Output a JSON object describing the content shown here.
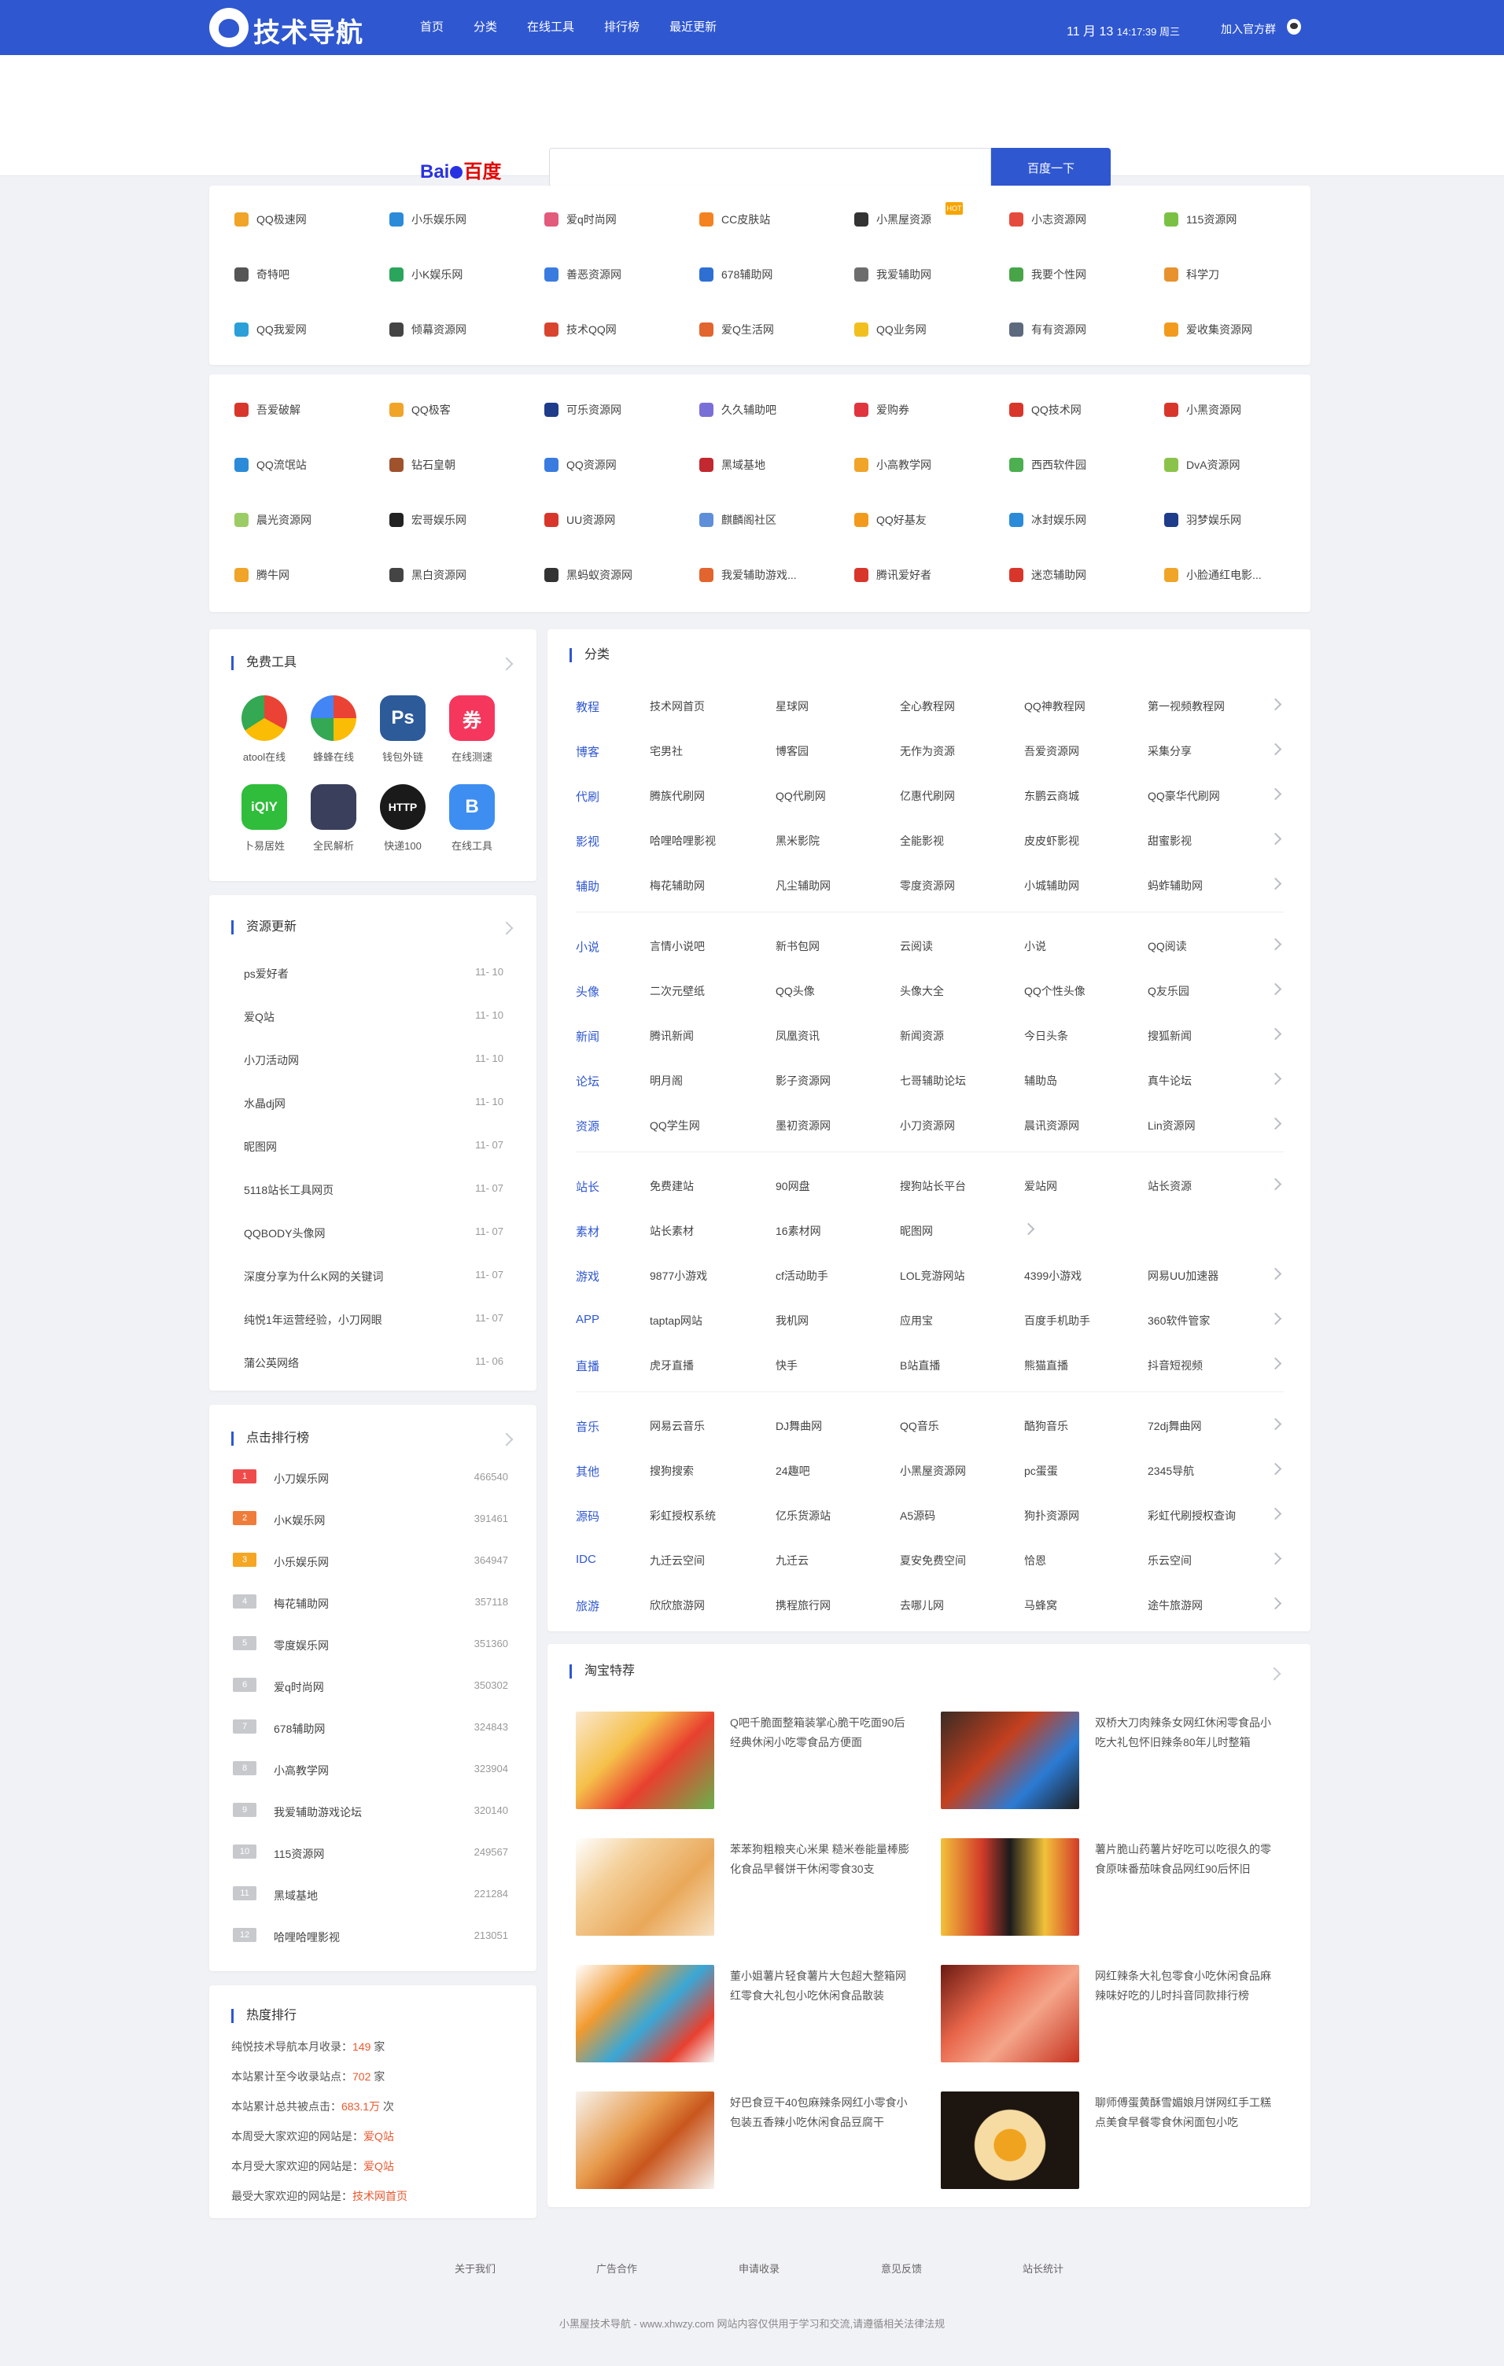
{
  "header": {
    "logo_text": "技术导航",
    "nav": [
      "首页",
      "分类",
      "在线工具",
      "排行榜",
      "最近更新"
    ],
    "date": "11 月 13",
    "time": "14:17:39 周三",
    "join_label": "加入官方群"
  },
  "search": {
    "engine": "百度",
    "button": "百度一下"
  },
  "sites_block1": [
    {
      "name": "QQ极速网",
      "color": "#f0a428"
    },
    {
      "name": "小乐娱乐网",
      "color": "#2b8bd8"
    },
    {
      "name": "爱q时尚网",
      "color": "#e25a7c"
    },
    {
      "name": "CC皮肤站",
      "color": "#f58220"
    },
    {
      "name": "小黑屋资源",
      "color": "#333333",
      "hot": "HOT"
    },
    {
      "name": "小志资源网",
      "color": "#e54b3c"
    },
    {
      "name": "115资源网",
      "color": "#7ac143"
    },
    {
      "name": "奇特吧",
      "color": "#555555"
    },
    {
      "name": "小K娱乐网",
      "color": "#2aa55c"
    },
    {
      "name": "善恶资源网",
      "color": "#3a7be0"
    },
    {
      "name": "678辅助网",
      "color": "#2e6fd4"
    },
    {
      "name": "我爱辅助网",
      "color": "#6d6d6d"
    },
    {
      "name": "我要个性网",
      "color": "#47a548"
    },
    {
      "name": "科学刀",
      "color": "#e8922e"
    },
    {
      "name": "QQ我爱网",
      "color": "#2b9fd8"
    },
    {
      "name": "倾幕资源网",
      "color": "#444444"
    },
    {
      "name": "技术QQ网",
      "color": "#d9442f"
    },
    {
      "name": "爱Q生活网",
      "color": "#e2642e"
    },
    {
      "name": "QQ业务网",
      "color": "#f2c01e"
    },
    {
      "name": "有有资源网",
      "color": "#5d6a7d"
    },
    {
      "name": "爱收集资源网",
      "color": "#f29a1e"
    }
  ],
  "sites_block2": [
    {
      "name": "吾爱破解",
      "color": "#d9362b"
    },
    {
      "name": "QQ极客",
      "color": "#f0a428"
    },
    {
      "name": "可乐资源网",
      "color": "#1f3c8a"
    },
    {
      "name": "久久辅助吧",
      "color": "#7a6fd6"
    },
    {
      "name": "爱购券",
      "color": "#e0353f"
    },
    {
      "name": "QQ技术网",
      "color": "#d9362b"
    },
    {
      "name": "小黑资源网",
      "color": "#d9362b"
    },
    {
      "name": "QQ流氓站",
      "color": "#2b8bd8"
    },
    {
      "name": "钻石皇朝",
      "color": "#a0522d"
    },
    {
      "name": "QQ资源网",
      "color": "#3a7be0"
    },
    {
      "name": "黑域基地",
      "color": "#c2282f"
    },
    {
      "name": "小高教学网",
      "color": "#f0a428"
    },
    {
      "name": "西西软件园",
      "color": "#4caf50"
    },
    {
      "name": "DvA资源网",
      "color": "#8bc34a"
    },
    {
      "name": "晨光资源网",
      "color": "#9ccc65"
    },
    {
      "name": "宏哥娱乐网",
      "color": "#222222"
    },
    {
      "name": "UU资源网",
      "color": "#d9362b"
    },
    {
      "name": "麒麟阁社区",
      "color": "#5f8fd9"
    },
    {
      "name": "QQ好基友",
      "color": "#f29a1e"
    },
    {
      "name": "冰封娱乐网",
      "color": "#2b8bd8"
    },
    {
      "name": "羽梦娱乐网",
      "color": "#1f3c8a"
    },
    {
      "name": "腾牛网",
      "color": "#f0a428"
    },
    {
      "name": "黑白资源网",
      "color": "#444444"
    },
    {
      "name": "黑蚂蚁资源网",
      "color": "#333333"
    },
    {
      "name": "我爱辅助游戏...",
      "color": "#e2642e"
    },
    {
      "name": "腾讯爱好者",
      "color": "#d9362b"
    },
    {
      "name": "迷恋辅助网",
      "color": "#d9362b"
    },
    {
      "name": "小脸通红电影...",
      "color": "#f0a428"
    }
  ],
  "tools": {
    "title": "免费工具",
    "apps": [
      {
        "label": "atool在线",
        "glyph": "",
        "color": "#ffffff"
      },
      {
        "label": "蜂蜂在线",
        "glyph": "",
        "color": "#ffffff"
      },
      {
        "label": "钱包外链",
        "glyph": "Ps",
        "color": "#2d5b9a"
      },
      {
        "label": "在线测速",
        "glyph": "券",
        "color": "#f5375d"
      },
      {
        "label": "卜易居姓",
        "glyph": "iQIY",
        "color": "#2fbd3b"
      },
      {
        "label": "全民解析",
        "glyph": "",
        "color": "#3a3f5c"
      },
      {
        "label": "快递100",
        "glyph": "HTTP",
        "color": "#1a1a1a"
      },
      {
        "label": "在线工具",
        "glyph": "B",
        "color": "#3d8ef0"
      }
    ]
  },
  "resources": {
    "title": "资源更新",
    "items": [
      {
        "name": "ps爱好者",
        "date": "11- 10"
      },
      {
        "name": "爱Q站",
        "date": "11- 10"
      },
      {
        "name": "小刀活动网",
        "date": "11- 10"
      },
      {
        "name": "水晶dj网",
        "date": "11- 10"
      },
      {
        "name": "昵图网",
        "date": "11- 07"
      },
      {
        "name": "5118站长工具网页",
        "date": "11- 07"
      },
      {
        "name": "QQBODY头像网",
        "date": "11- 07"
      },
      {
        "name": "深度分享为什么K网的关键词",
        "date": "11- 07"
      },
      {
        "name": "纯悦1年运营经验，小刀网眼",
        "date": "11- 07"
      },
      {
        "name": "蒲公英网络",
        "date": "11- 06"
      }
    ]
  },
  "ranking": {
    "title": "点击排行榜",
    "items": [
      {
        "num": "1",
        "name": "小刀娱乐网",
        "val": "466540",
        "color": "#f04b4b"
      },
      {
        "num": "2",
        "name": "小K娱乐网",
        "val": "391461",
        "color": "#f07c3a"
      },
      {
        "num": "3",
        "name": "小乐娱乐网",
        "val": "364947",
        "color": "#f5a623"
      },
      {
        "num": "4",
        "name": "梅花辅助网",
        "val": "357118",
        "color": "#c7c9cd"
      },
      {
        "num": "5",
        "name": "零度娱乐网",
        "val": "351360",
        "color": "#c7c9cd"
      },
      {
        "num": "6",
        "name": "爱q时尚网",
        "val": "350302",
        "color": "#c7c9cd"
      },
      {
        "num": "7",
        "name": "678辅助网",
        "val": "324843",
        "color": "#c7c9cd"
      },
      {
        "num": "8",
        "name": "小高教学网",
        "val": "323904",
        "color": "#c7c9cd"
      },
      {
        "num": "9",
        "name": "我爱辅助游戏论坛",
        "val": "320140",
        "color": "#c7c9cd"
      },
      {
        "num": "10",
        "name": "115资源网",
        "val": "249567",
        "color": "#c7c9cd"
      },
      {
        "num": "11",
        "name": "黑域基地",
        "val": "221284",
        "color": "#c7c9cd"
      },
      {
        "num": "12",
        "name": "哈哩哈哩影视",
        "val": "213051",
        "color": "#c7c9cd"
      }
    ]
  },
  "hot": {
    "title": "热度排行",
    "stats": [
      {
        "pre": "纯悦技术导航本月收录：",
        "val": "149",
        "post": " 家"
      },
      {
        "pre": "本站累计至今收录站点：",
        "val": "702",
        "post": " 家"
      },
      {
        "pre": "本站累计总共被点击：",
        "val": "683.1万",
        "post": " 次"
      },
      {
        "pre": "本周受大家欢迎的网站是：",
        "val": "爱Q站",
        "post": ""
      },
      {
        "pre": "本月受大家欢迎的网站是：",
        "val": "爱Q站",
        "post": ""
      },
      {
        "pre": "最受大家欢迎的网站是：",
        "val": "技术网首页",
        "post": ""
      }
    ]
  },
  "category": {
    "title": "分类",
    "rows": [
      {
        "label": "教程",
        "items": [
          "技术网首页",
          "星球网",
          "全心教程网",
          "QQ神教程网",
          "第一视频教程网"
        ]
      },
      {
        "label": "博客",
        "items": [
          "宅男社",
          "博客园",
          "无作为资源",
          "吾爱资源网",
          "采集分享"
        ]
      },
      {
        "label": "代刷",
        "items": [
          "腾族代刷网",
          "QQ代刷网",
          "亿惠代刷网",
          "东鹏云商城",
          "QQ豪华代刷网"
        ]
      },
      {
        "label": "影视",
        "items": [
          "哈哩哈哩影视",
          "黑米影院",
          "全能影视",
          "皮皮虾影视",
          "甜蜜影视"
        ]
      },
      {
        "label": "辅助",
        "items": [
          "梅花辅助网",
          "凡尘辅助网",
          "零度资源网",
          "小城辅助网",
          "蚂蚱辅助网"
        ]
      },
      {
        "label": "小说",
        "items": [
          "言情小说吧",
          "新书包网",
          "云阅读",
          "小说",
          "QQ阅读"
        ]
      },
      {
        "label": "头像",
        "items": [
          "二次元壁纸",
          "QQ头像",
          "头像大全",
          "QQ个性头像",
          "Q友乐园"
        ]
      },
      {
        "label": "新闻",
        "items": [
          "腾讯新闻",
          "凤凰资讯",
          "新闻资源",
          "今日头条",
          "搜狐新闻"
        ]
      },
      {
        "label": "论坛",
        "items": [
          "明月阁",
          "影子资源网",
          "七哥辅助论坛",
          "辅助岛",
          "真牛论坛"
        ]
      },
      {
        "label": "资源",
        "items": [
          "QQ学生网",
          "墨初资源网",
          "小刀资源网",
          "晨讯资源网",
          "Lin资源网"
        ]
      },
      {
        "label": "站长",
        "items": [
          "免费建站",
          "90网盘",
          "搜狗站长平台",
          "爱站网",
          "站长资源"
        ]
      },
      {
        "label": "素材",
        "items": [
          "站长素材",
          "16素材网",
          "昵图网"
        ]
      },
      {
        "label": "游戏",
        "items": [
          "9877小游戏",
          "cf活动助手",
          "LOL竞游网站",
          "4399小游戏",
          "网易UU加速器"
        ]
      },
      {
        "label": "APP",
        "items": [
          "taptap网站",
          "我机网",
          "应用宝",
          "百度手机助手",
          "360软件管家"
        ]
      },
      {
        "label": "直播",
        "items": [
          "虎牙直播",
          "快手",
          "B站直播",
          "熊猫直播",
          "抖音短视频"
        ]
      },
      {
        "label": "音乐",
        "items": [
          "网易云音乐",
          "DJ舞曲网",
          "QQ音乐",
          "酷狗音乐",
          "72dj舞曲网"
        ]
      },
      {
        "label": "其他",
        "items": [
          "搜狗搜索",
          "24趣吧",
          "小黑屋资源网",
          "pc蛋蛋",
          "2345导航"
        ]
      },
      {
        "label": "源码",
        "items": [
          "彩虹授权系统",
          "亿乐货源站",
          "A5源码",
          "狗扑资源网",
          "彩虹代刷授权查询"
        ]
      },
      {
        "label": "IDC",
        "items": [
          "九迁云空间",
          "九迁云",
          "夏安免费空间",
          "恰恩",
          "乐云空间"
        ]
      },
      {
        "label": "旅游",
        "items": [
          "欣欣旅游网",
          "携程旅行网",
          "去哪儿网",
          "马蜂窝",
          "途牛旅游网"
        ]
      }
    ]
  },
  "taobao": {
    "title": "淘宝特荐",
    "items": [
      {
        "text": "Q吧千脆面整箱装掌心脆干吃面90后经典休闲小吃零食品方便面"
      },
      {
        "text": "双桥大刀肉辣条女网红休闲零食品小吃大礼包怀旧辣条80年儿时整箱"
      },
      {
        "text": "苯苯狗粗粮夹心米果 糙米卷能量棒膨化食品早餐饼干休闲零食30支"
      },
      {
        "text": "薯片脆山药薯片好吃可以吃很久的零食原味番茄味食品网红90后怀旧"
      },
      {
        "text": "董小姐薯片轻食薯片大包超大整箱网红零食大礼包小吃休闲食品散装"
      },
      {
        "text": "网红辣条大礼包零食小吃休闲食品麻辣味好吃的儿时抖音同款排行榜"
      },
      {
        "text": "好巴食豆干40包麻辣条网红小零食小包装五香辣小吃休闲食品豆腐干"
      },
      {
        "text": "聊师傅蛋黄酥雪媚娘月饼网红手工糕点美食早餐零食休闲面包小吃"
      }
    ]
  },
  "footer": {
    "links": [
      "关于我们",
      "广告合作",
      "申请收录",
      "意见反馈",
      "站长统计"
    ],
    "copyright": "小黑屋技术导航 - www.xhwzy.com 网站内容仅供用于学习和交流,请遵循相关法律法规"
  }
}
